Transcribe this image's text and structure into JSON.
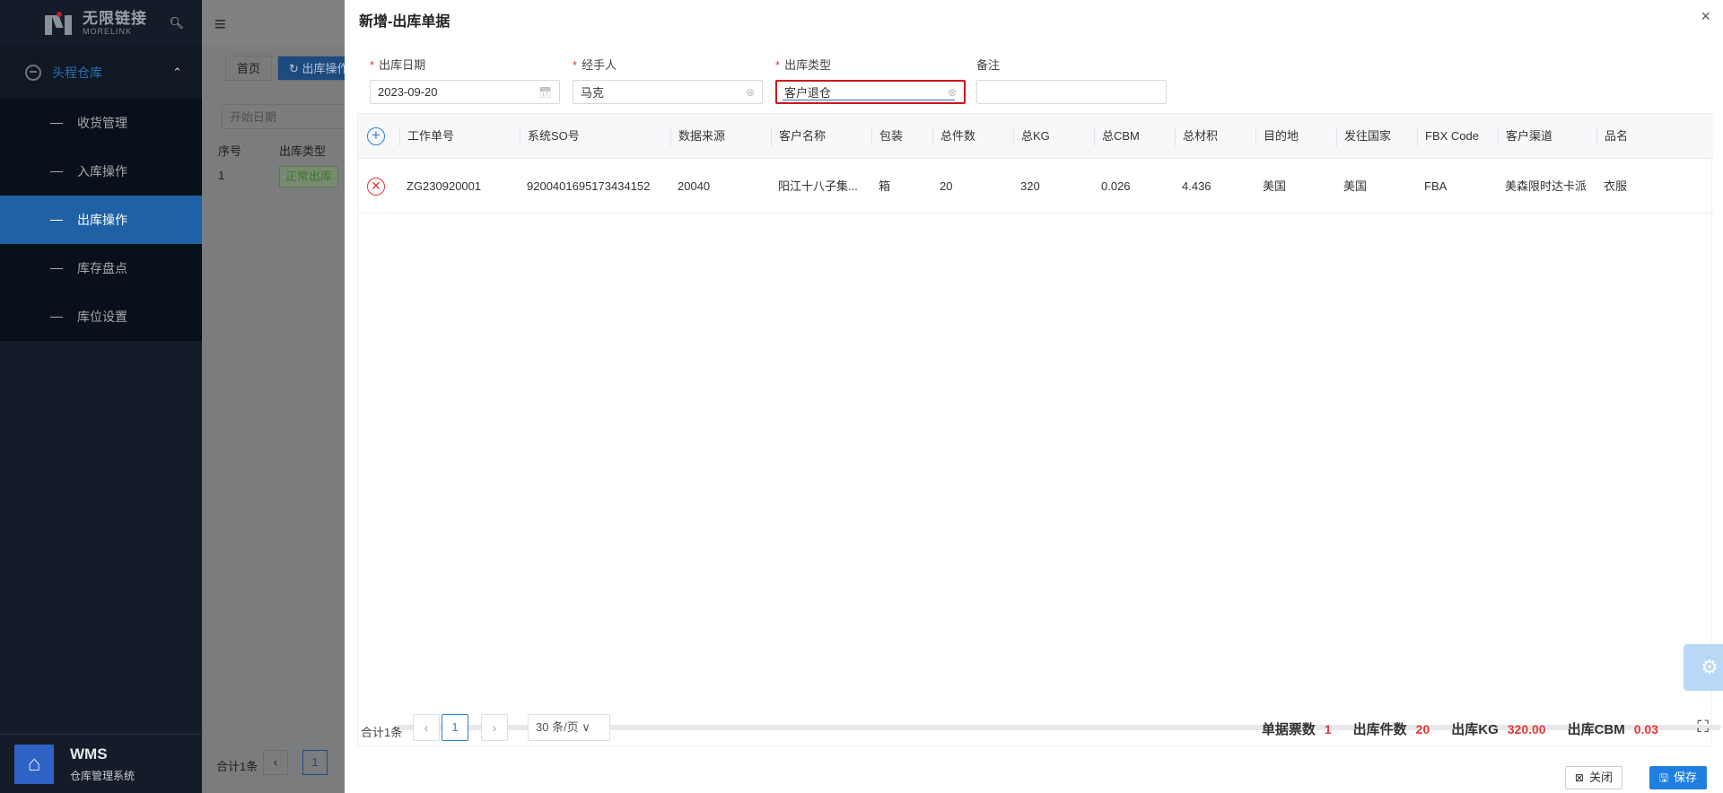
{
  "sidebar": {
    "brand_cn": "无限链接",
    "brand_en": "MORELINK",
    "group": "头程仓库",
    "items": [
      {
        "label": "收货管理"
      },
      {
        "label": "入库操作"
      },
      {
        "label": "出库操作"
      },
      {
        "label": "库存盘点"
      },
      {
        "label": "库位设置"
      }
    ],
    "footer_title": "WMS",
    "footer_sub": "仓库管理系统"
  },
  "background_page": {
    "tabs": [
      "首页",
      "出库操作"
    ],
    "date_placeholder": "开始日期",
    "col_index": "序号",
    "col_type": "出库类型",
    "row_index": "1",
    "row_type": "正常出库",
    "total": "合计1条",
    "page": "1"
  },
  "drawer": {
    "title": "新增-出库单据",
    "close_icon": "×",
    "fields": {
      "date": {
        "label": "出库日期",
        "value": "2023-09-20",
        "required": true
      },
      "handler": {
        "label": "经手人",
        "value": "马克",
        "required": true
      },
      "type": {
        "label": "出库类型",
        "value": "客户退仓",
        "required": true
      },
      "remark": {
        "label": "备注",
        "value": "",
        "required": false
      }
    },
    "table": {
      "headers": [
        "工作单号",
        "系统SO号",
        "数据来源",
        "客户名称",
        "包装",
        "总件数",
        "总KG",
        "总CBM",
        "总材积",
        "目的地",
        "发往国家",
        "FBX Code",
        "客户渠道",
        "品名"
      ],
      "rows": [
        [
          "ZG230920001",
          "9200401695173434152",
          "20040",
          "阳江十八子集...",
          "箱",
          "20",
          "320",
          "0.026",
          "4.436",
          "美国",
          "美国",
          "FBA",
          "美森限时达卡派",
          "衣服"
        ]
      ]
    },
    "pagination": {
      "total": "合计1条",
      "current": "1",
      "page_size": "30 条/页"
    },
    "stats": {
      "tickets_label": "单据票数",
      "tickets_value": "1",
      "pieces_label": "出库件数",
      "pieces_value": "20",
      "kg_label": "出库KG",
      "kg_value": "320.00",
      "cbm_label": "出库CBM",
      "cbm_value": "0.03"
    },
    "buttons": {
      "close": "关闭",
      "save": "保存"
    }
  },
  "colors": {
    "primary": "#1f7fe0",
    "danger": "#e53935",
    "sidebar_bg": "#131c28",
    "active_menu": "#2061a6"
  }
}
